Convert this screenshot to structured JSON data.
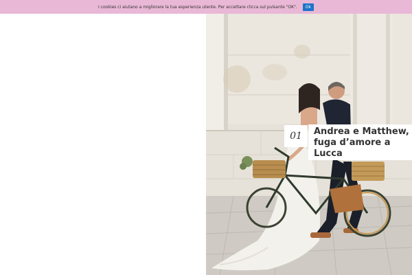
{
  "cookie_bar": {
    "message": "I cookies ci aiutano a migliorare la tua esperienza utente. Per accettare clicca sul pulsante \"OK\".",
    "ok_label": "Ok",
    "background_color": "#e9b8d6",
    "button_color": "#1a73c8"
  },
  "featured": {
    "number": "01",
    "title": "Andrea e Matthew, fuga d’amore a Lucca",
    "image_description_icon": "wedding-photo"
  }
}
